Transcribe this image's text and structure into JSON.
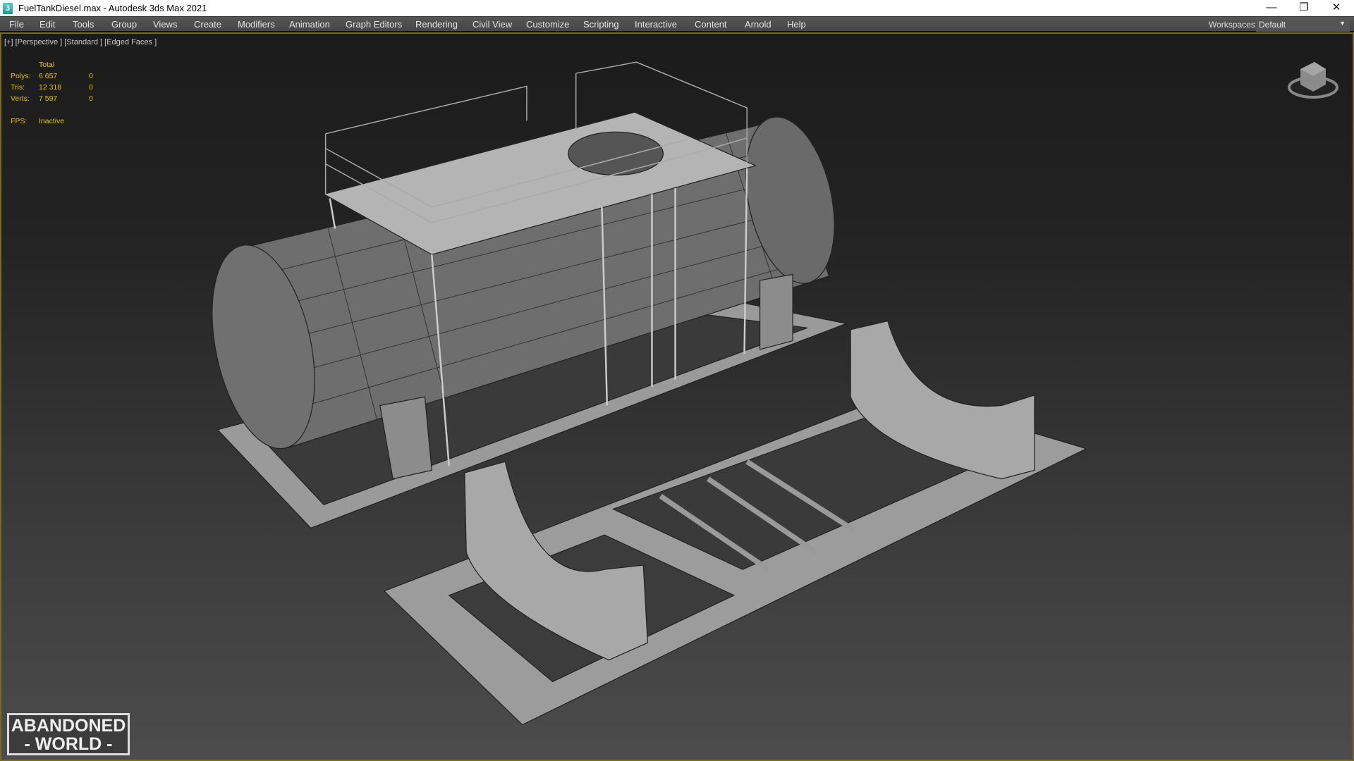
{
  "window": {
    "title": "FuelTankDiesel.max - Autodesk 3ds Max 2021",
    "app_icon": "3",
    "controls": {
      "minimize": "—",
      "restore": "❐",
      "close": "✕"
    }
  },
  "menu": [
    "File",
    "Edit",
    "Tools",
    "Group",
    "Views",
    "Create",
    "Modifiers",
    "Animation",
    "Graph Editors",
    "Rendering",
    "Civil View",
    "Customize",
    "Scripting",
    "Interactive",
    "Content",
    "Arnold",
    "Help"
  ],
  "workspaces": {
    "label": "Workspaces:",
    "value": "Default"
  },
  "viewport": {
    "label": "[+] [Perspective ] [Standard ] [Edged Faces ]"
  },
  "stats": {
    "header": "Total",
    "rows": [
      {
        "label": "Polys:",
        "total": "6 657",
        "sel": "0"
      },
      {
        "label": "Tris:",
        "total": "12 318",
        "sel": "0"
      },
      {
        "label": "Verts:",
        "total": "7 597",
        "sel": "0"
      }
    ],
    "fps_label": "FPS:",
    "fps_value": "Inactive"
  },
  "logo": {
    "line1": "ABANDONED",
    "line2": "- WORLD -"
  },
  "colors": {
    "accent": "#7a6a2a",
    "stats": "#e0c000"
  }
}
